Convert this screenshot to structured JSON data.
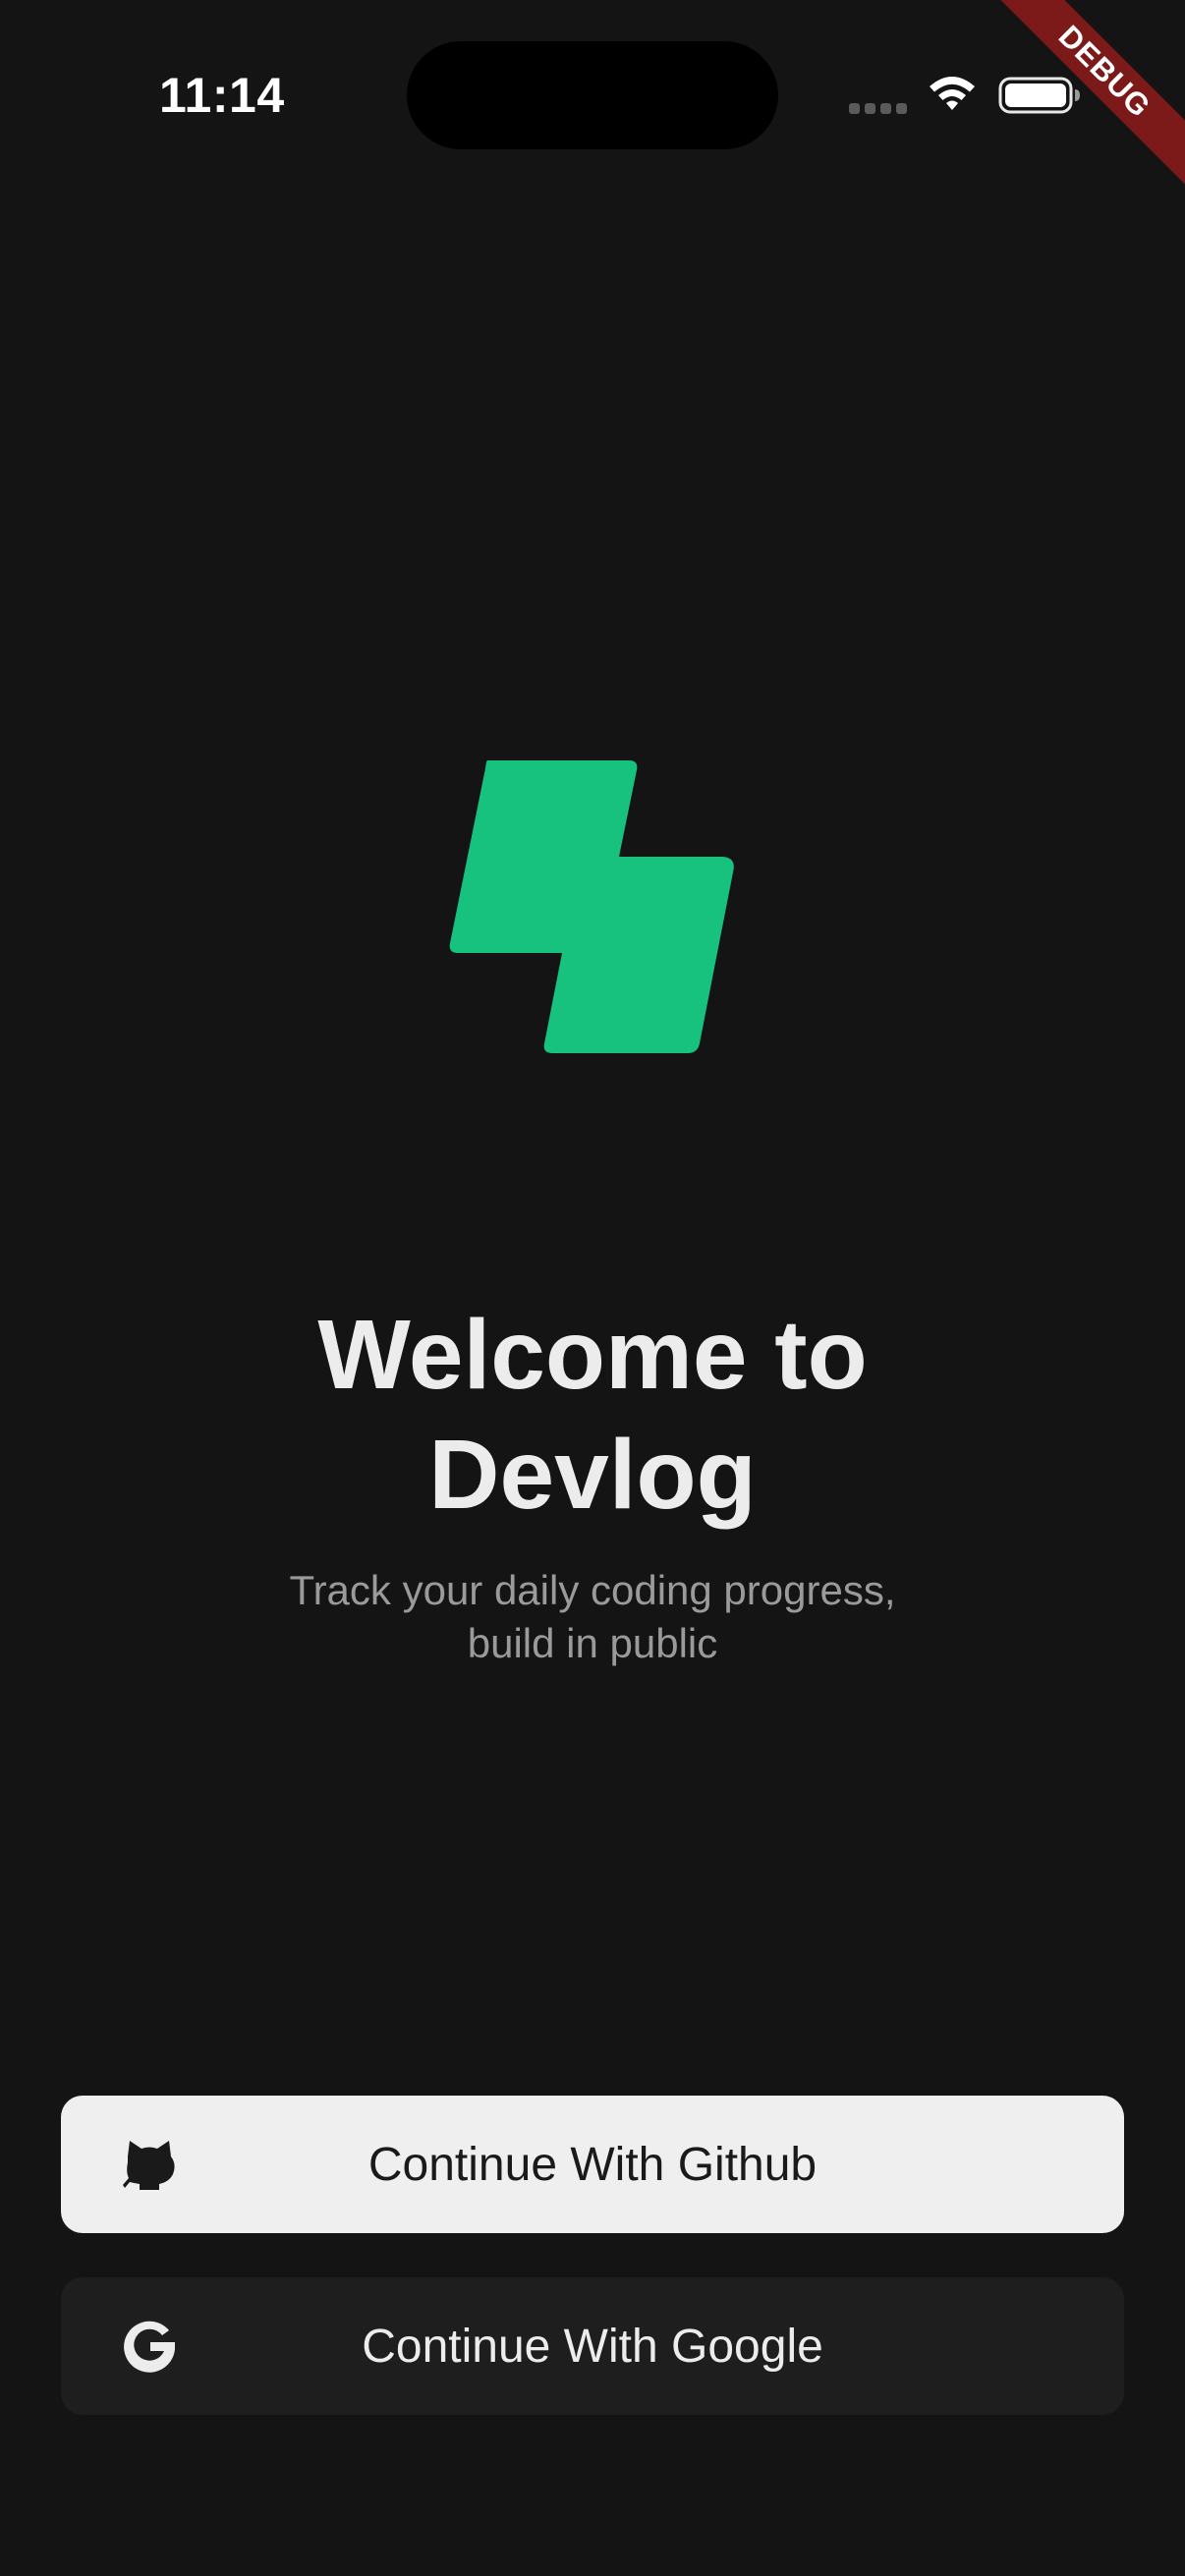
{
  "status_bar": {
    "time": "11:14"
  },
  "debug_banner": {
    "label": "DEBUG",
    "color": "#7c1a1a"
  },
  "brand": {
    "accent": "#17c27f",
    "logo_icon": "devlog-logo-icon"
  },
  "welcome": {
    "title_line1": "Welcome to",
    "title_line2": "Devlog",
    "subtitle_line1": "Track your daily coding progress,",
    "subtitle_line2": "build in public"
  },
  "auth": {
    "github": {
      "label": "Continue With Github",
      "icon": "github-icon"
    },
    "google": {
      "label": "Continue With Google",
      "icon": "google-icon"
    }
  }
}
